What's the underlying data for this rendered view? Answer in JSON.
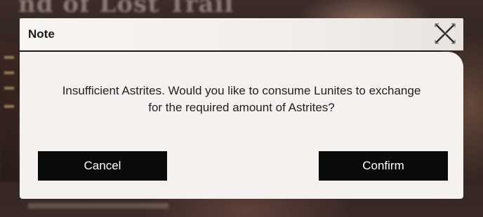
{
  "background": {
    "title_fragment": "nd of Lost Trail"
  },
  "dialog": {
    "title": "Note",
    "close_icon": "close-x-icon",
    "message_line1": "Insufficient Astrites. Would you like to consume Lunites to exchange",
    "message_line2": "for the required amount of Astrites?",
    "cancel_label": "Cancel",
    "confirm_label": "Confirm"
  },
  "colors": {
    "panel": "#f4f1ef",
    "button": "#0a0a0a",
    "button_text": "#ffffff",
    "text": "#1f1f1f"
  }
}
